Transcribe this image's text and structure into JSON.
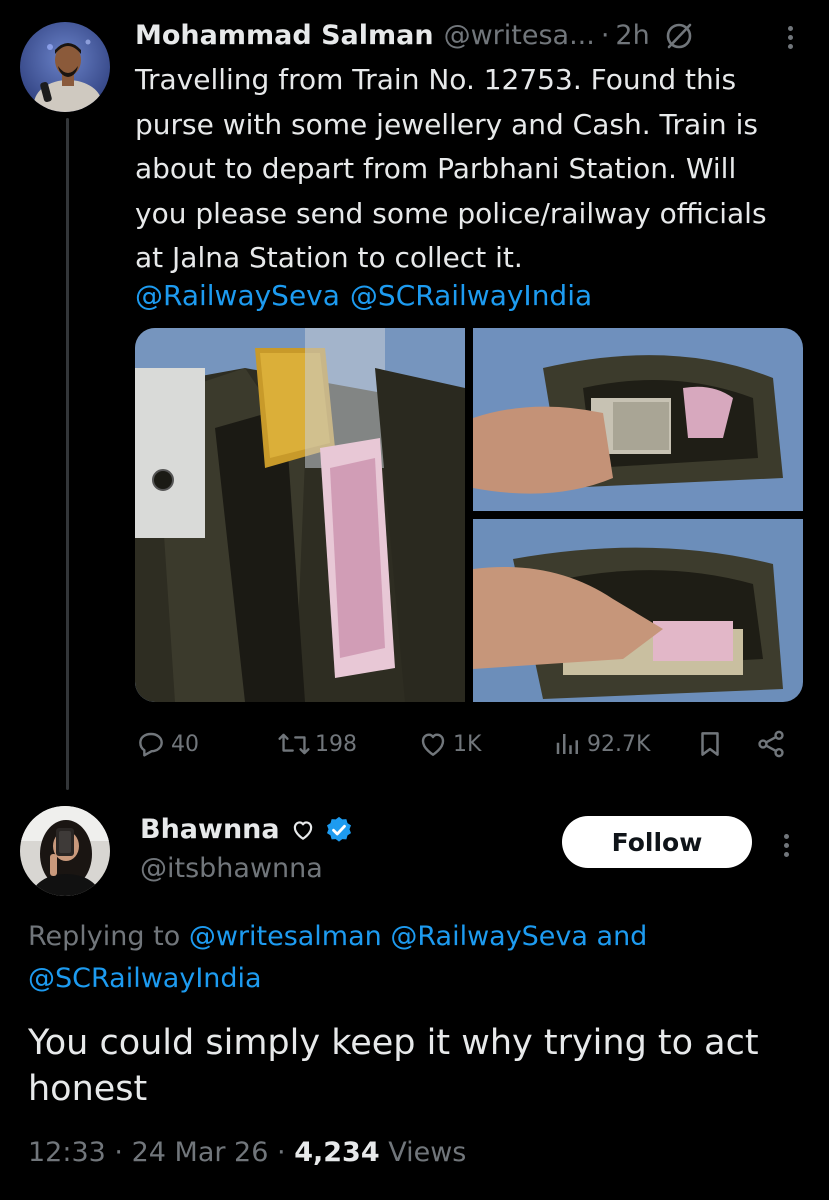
{
  "tweet": {
    "author_name": "Mohammad Salman",
    "author_handle": "@writesa...",
    "separator": "·",
    "time": "2h",
    "text": "Travelling from Train No. 12753. Found this\npurse with some jewellery and Cash. Train is\nabout to depart from Parbhani Station. Will\nyou please send some police/railway officials\nat Jalna Station to collect it.",
    "mentions": [
      "@RailwaySeva",
      "@SCRailwayIndia"
    ],
    "stats": {
      "replies": "40",
      "reposts": "198",
      "likes": "1K",
      "views": "92.7K"
    }
  },
  "reply": {
    "author_name": "Bhawnna",
    "author_handle": "@itsbhawnna",
    "follow_label": "Follow",
    "replying_prefix": "Replying to",
    "replying_handles": "@writesalman @RailwaySeva and",
    "replying_handles_2": "@SCRailwayIndia",
    "text": "You could simply keep it why trying to act honest",
    "time": "12:33",
    "date": "24 Mar 26",
    "views_count": "4,234",
    "views_label": "Views",
    "dot": "·"
  },
  "colors": {
    "background": "#000000",
    "text": "#e7e9ea",
    "muted": "#71767b",
    "link": "#1d9bf0"
  },
  "icons": [
    "grok-icon",
    "more-icon",
    "reply-icon",
    "repost-icon",
    "like-icon",
    "views-icon",
    "bookmark-icon",
    "share-icon",
    "heart-outline-icon",
    "verified-badge-icon"
  ]
}
